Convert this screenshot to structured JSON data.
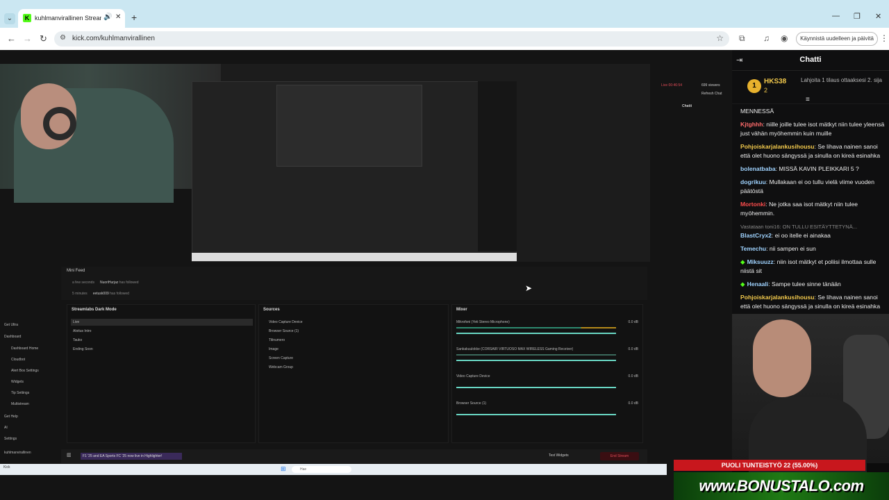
{
  "browser": {
    "tab_title": "kuhlmanvirallinen Stream",
    "tab_favicon": "K",
    "url": "kick.com/kuhlmanvirallinen",
    "restart_label": "Käynnistä uudelleen ja päivitä"
  },
  "slobs": {
    "mini_feed_title": "Mini Feed",
    "feed": [
      {
        "time": "a few seconds",
        "user": "NuoriHurjaz",
        "text": "has followed"
      },
      {
        "time": "5 minutes",
        "user": "eetusk009",
        "text": "has followed"
      }
    ],
    "scenes_title": "Streamlabs Dark Mode",
    "scenes": [
      "Live",
      "Aloitus Intro",
      "Tauko",
      "Ending Soon"
    ],
    "sources_title": "Sources",
    "sources": [
      "Video Capture Device",
      "Browser Source (1)",
      "Tilinumero",
      "Image",
      "Screen Capture",
      "Webcam Group"
    ],
    "mixer_title": "Mixer",
    "mixer": [
      {
        "name": "Mikrofoni (Yeti Stereo Microphone)",
        "db": "0.0 dB"
      },
      {
        "name": "Sankakuulokke (CORSAIR VIRTUOSO MAX WIRELESS Gaming Receiver)",
        "db": "0.0 dB"
      },
      {
        "name": "Video Capture Device",
        "db": "0.0 dB"
      },
      {
        "name": "Browser Source (1)",
        "db": "0.0 dB"
      }
    ],
    "sidebar": [
      "Get Ultra",
      "Dashboard",
      "Dashboard Home",
      "Cloudbot",
      "Alert Box Settings",
      "Widgets",
      "Tip Settings",
      "Multistream",
      "Get Help",
      "AI",
      "Settings",
      "kuhlmanvirallinen"
    ],
    "ticker": "F1 '25 and EA Sports FC '25 now live in Highlighter!",
    "test_widgets": "Test Widgets",
    "end_stream": "End Stream",
    "live_status": "Live 00:46:54",
    "viewers": "699 viewers",
    "refresh_chat": "Refresh Chat",
    "inner_chat_title": "Chatti",
    "taskbar_search": "Hae",
    "kick_label": "Kick"
  },
  "chat": {
    "title": "Chatti",
    "pinned": {
      "rank": "1",
      "user": "HKS38",
      "count": "2",
      "text": "Lahjoita 1 tilaus ottaaksesi 2. sija"
    },
    "carry_text": "MENNESSÄ",
    "messages": [
      {
        "user": "Kjtghhh",
        "color": "#ff6b6b",
        "text": "niille joille tulee isot mätkyt niin tulee yleensä just vähän myöhemmin kuin muille"
      },
      {
        "user": "Pohjoiskarjalankusihousu",
        "color": "#f2c94c",
        "text": "Se lihava nainen sanoi että olet huono sängyssä ja sinulla on kireä esinahka"
      },
      {
        "user": "bolenatbaba",
        "color": "#9fd3ff",
        "text": "MISSÄ KAVIN PLEIKKARI 5 ?"
      },
      {
        "user": "dogrikuu",
        "color": "#9fd3ff",
        "text": "Mullakaan ei oo tullu vielä viime vuoden päätöstä"
      },
      {
        "user": "Mortonki",
        "color": "#ff4d4d",
        "text": "Ne jotka saa isot mätkyt niin tulee myöhemmin."
      },
      {
        "reply": "Vastataan toni16: ON TULLU ESITÄYTTETYNÄ...",
        "user": "BlastCryx2",
        "color": "#9fd3ff",
        "text": "ei oo itelle ei ainakaa"
      },
      {
        "user": "Temechu",
        "color": "#9fd3ff",
        "text": "nii sampen ei sun"
      },
      {
        "gem": true,
        "user": "Miksuuzz",
        "color": "#9fd3ff",
        "text": "niin isot mätkyt et poliisi ilmottaa sulle niistä sit"
      },
      {
        "gem": true,
        "user": "Henaali",
        "color": "#9fd3ff",
        "text": "Sampe tulee sinne tänään"
      },
      {
        "user": "Pohjoiskarjalankusihousu",
        "color": "#f2c94c",
        "text": "Se lihava nainen sanoi että olet huono sängyssä ja sinulla on kireä esinahka"
      }
    ]
  },
  "promo": {
    "top": "PUOLI TUNTEISTYÖ",
    "sub": "22 (55.00%)",
    "brand": "www.BONUSTALO.com"
  }
}
